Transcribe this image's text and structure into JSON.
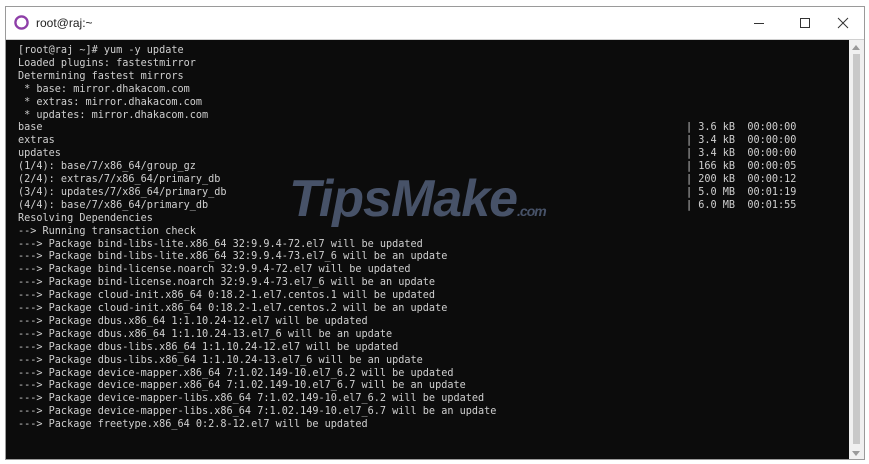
{
  "window": {
    "title": "root@raj:~",
    "minimize_icon": "minimize-icon",
    "maximize_icon": "maximize-icon",
    "close_icon": "close-icon"
  },
  "terminal": {
    "lines": [
      "[root@raj ~]# yum -y update",
      "Loaded plugins: fastestmirror",
      "Determining fastest mirrors",
      " * base: mirror.dhakacom.com",
      " * extras: mirror.dhakacom.com",
      " * updates: mirror.dhakacom.com",
      "base",
      "extras",
      "updates",
      "(1/4): base/7/x86_64/group_gz",
      "(2/4): extras/7/x86_64/primary_db",
      "(3/4): updates/7/x86_64/primary_db",
      "(4/4): base/7/x86_64/primary_db",
      "Resolving Dependencies",
      "--> Running transaction check",
      "---> Package bind-libs-lite.x86_64 32:9.9.4-72.el7 will be updated",
      "---> Package bind-libs-lite.x86_64 32:9.9.4-73.el7_6 will be an update",
      "---> Package bind-license.noarch 32:9.9.4-72.el7 will be updated",
      "---> Package bind-license.noarch 32:9.9.4-73.el7_6 will be an update",
      "---> Package cloud-init.x86_64 0:18.2-1.el7.centos.1 will be updated",
      "---> Package cloud-init.x86_64 0:18.2-1.el7.centos.2 will be an update",
      "---> Package dbus.x86_64 1:1.10.24-12.el7 will be updated",
      "---> Package dbus.x86_64 1:1.10.24-13.el7_6 will be an update",
      "---> Package dbus-libs.x86_64 1:1.10.24-12.el7 will be updated",
      "---> Package dbus-libs.x86_64 1:1.10.24-13.el7_6 will be an update",
      "---> Package device-mapper.x86_64 7:1.02.149-10.el7_6.2 will be updated",
      "---> Package device-mapper.x86_64 7:1.02.149-10.el7_6.7 will be an update",
      "---> Package device-mapper-libs.x86_64 7:1.02.149-10.el7_6.2 will be updated",
      "---> Package device-mapper-libs.x86_64 7:1.02.149-10.el7_6.7 will be an update",
      "---> Package freetype.x86_64 0:2.8-12.el7 will be updated"
    ],
    "right_column": [
      {
        "line": 6,
        "text": "| 3.6 kB  00:00:00"
      },
      {
        "line": 7,
        "text": "| 3.4 kB  00:00:00"
      },
      {
        "line": 8,
        "text": "| 3.4 kB  00:00:00"
      },
      {
        "line": 9,
        "text": "| 166 kB  00:00:05"
      },
      {
        "line": 10,
        "text": "| 200 kB  00:00:12"
      },
      {
        "line": 11,
        "text": "| 5.0 MB  00:01:19"
      },
      {
        "line": 12,
        "text": "| 6.0 MB  00:01:55"
      }
    ]
  },
  "watermark": {
    "text": "TipsMake",
    "suffix": ".com"
  }
}
